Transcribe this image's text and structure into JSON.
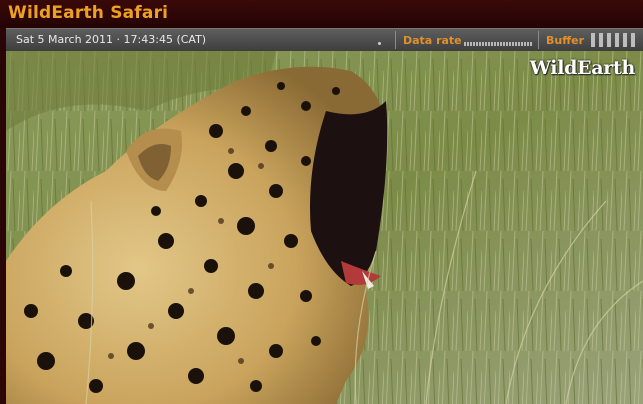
{
  "app": {
    "title": "WildEarth Safari"
  },
  "status": {
    "timestamp": "Sat 5 March 2011 · 17:43:45 (CAT)",
    "data_rate_label": "Data rate",
    "buffer_label": "Buffer",
    "buffer_level": 1.0
  },
  "video": {
    "watermark": "WildEarth",
    "subject": "leopard yawning in grass"
  },
  "colors": {
    "title": "#f0a020",
    "status_label": "#e0912c",
    "background": "#2a0606"
  }
}
